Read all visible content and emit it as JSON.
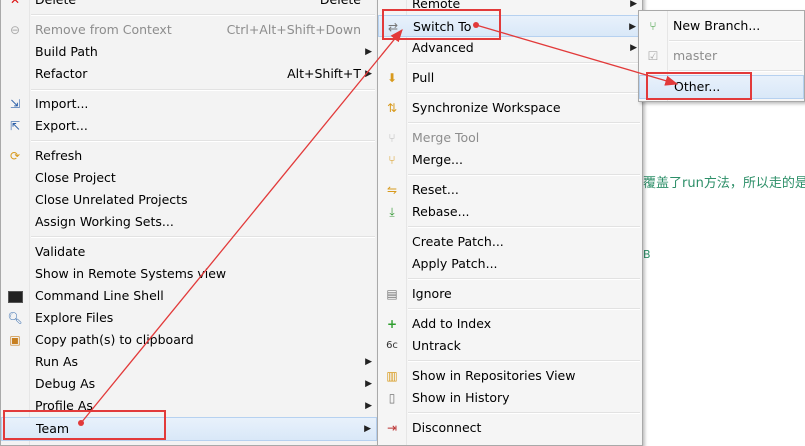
{
  "menu1": {
    "items": [
      {
        "label": "Delete",
        "shortcut": "Delete",
        "icon": "delete-icon",
        "disabled": false
      },
      {
        "label": "Remove from Context",
        "shortcut": "Ctrl+Alt+Shift+Down",
        "icon": "remove-context-icon",
        "disabled": true
      },
      {
        "label": "Build Path",
        "arrow": "▶"
      },
      {
        "label": "Refactor",
        "shortcut": "Alt+Shift+T",
        "arrow": "▶"
      },
      {
        "label": "Import...",
        "icon": "import-icon"
      },
      {
        "label": "Export...",
        "icon": "export-icon"
      },
      {
        "label": "Refresh",
        "icon": "refresh-icon"
      },
      {
        "label": "Close Project"
      },
      {
        "label": "Close Unrelated Projects"
      },
      {
        "label": "Assign Working Sets..."
      },
      {
        "label": "Validate"
      },
      {
        "label": "Show in Remote Systems view"
      },
      {
        "label": "Command Line Shell",
        "icon": "terminal-icon"
      },
      {
        "label": "Explore Files",
        "icon": "explore-icon"
      },
      {
        "label": "Copy path(s) to clipboard",
        "icon": "clipboard-icon"
      },
      {
        "label": "Run As",
        "arrow": "▶"
      },
      {
        "label": "Debug As",
        "arrow": "▶"
      },
      {
        "label": "Profile As",
        "arrow": "▶"
      },
      {
        "label": "Team",
        "arrow": "▶"
      }
    ]
  },
  "menu2": {
    "items": [
      {
        "label": "Remote",
        "arrow": "▶"
      },
      {
        "label": "Switch To",
        "arrow": "▶",
        "icon": "switch-icon"
      },
      {
        "label": "Advanced",
        "arrow": "▶"
      },
      {
        "label": "Pull",
        "icon": "pull-icon"
      },
      {
        "label": "Synchronize Workspace",
        "icon": "sync-icon"
      },
      {
        "label": "Merge Tool",
        "icon": "merge-tool-icon",
        "disabled": true
      },
      {
        "label": "Merge...",
        "icon": "merge-icon"
      },
      {
        "label": "Reset...",
        "icon": "reset-icon"
      },
      {
        "label": "Rebase...",
        "icon": "rebase-icon"
      },
      {
        "label": "Create Patch..."
      },
      {
        "label": "Apply Patch..."
      },
      {
        "label": "Ignore",
        "icon": "ignore-icon"
      },
      {
        "label": "Add to Index",
        "icon": "add-icon"
      },
      {
        "label": "Untrack",
        "icon": "untrack-icon"
      },
      {
        "label": "Show in Repositories View",
        "icon": "repo-icon"
      },
      {
        "label": "Show in History",
        "icon": "history-icon"
      },
      {
        "label": "Disconnect",
        "icon": "disconnect-icon"
      }
    ]
  },
  "menu3": {
    "items": [
      {
        "label": "New Branch...",
        "icon": "new-branch-icon"
      },
      {
        "label": "master",
        "icon": "branch-icon",
        "disabled": true
      },
      {
        "label": "Other..."
      }
    ]
  },
  "editor": {
    "line1": "覆盖了run方法，所以走的是",
    "line2": "B"
  },
  "colors": {
    "annotation": "#e23a3a",
    "highlight": "#d9e8f8",
    "editor_text": "#2d8f68"
  }
}
